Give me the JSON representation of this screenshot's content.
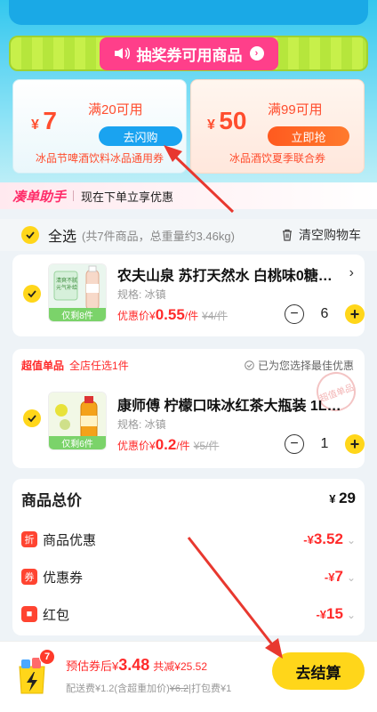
{
  "banner": {
    "title": "抽奖券可用商品"
  },
  "coupons": [
    {
      "currency": "¥",
      "amount": "7",
      "condition": "满20可用",
      "button": "去闪购",
      "desc": "冰品节啤酒饮料冰品通用券"
    },
    {
      "currency": "¥",
      "amount": "50",
      "condition": "满99可用",
      "button": "立即抢",
      "desc": "冰品酒饮夏季联合券"
    }
  ],
  "helper": {
    "tag": "凑单助手",
    "text": "现在下单立享优惠"
  },
  "select_all": {
    "label": "全选",
    "summary": "(共7件商品，总重量约3.46kg)",
    "clear": "清空购物车"
  },
  "products": [
    {
      "name": "农夫山泉 苏打天然水 白桃味0糖…",
      "spec": "规格: 冰镇",
      "price_label": "优惠价",
      "price_currency": "¥",
      "price": "0.55",
      "price_unit": "/件",
      "original": "¥4/件",
      "qty": "6",
      "badge": "仅剩8件"
    },
    {
      "name": "康师傅 柠檬口味冰红茶大瓶装 1L…",
      "spec": "规格: 冰镇",
      "price_label": "优惠价",
      "price_currency": "¥",
      "price": "0.2",
      "price_unit": "/件",
      "original": "¥5/件",
      "qty": "1",
      "badge": "仅剩6件",
      "tag1": "超值单品",
      "tag2": "全店任选1件",
      "best_option": "已为您选择最佳优惠",
      "stamp": "超值单品"
    }
  ],
  "summary": {
    "total_label": "商品总价",
    "total_currency": "¥",
    "total_value": "29",
    "rows": [
      {
        "icon": "折",
        "label": "商品优惠",
        "prefix": "-¥",
        "value": "3.52"
      },
      {
        "icon": "券",
        "label": "优惠券",
        "prefix": "-¥",
        "value": "7"
      },
      {
        "icon": "■",
        "label": "红包",
        "prefix": "-¥",
        "value": "15"
      }
    ]
  },
  "bottom": {
    "cart_count": "7",
    "est_label": "预估券后",
    "est_currency": "¥",
    "est_value": "3.48",
    "saved": "共减¥25.52",
    "fee_prefix": "配送费¥1.2(含超重加价)",
    "fee_strike": "¥6.2",
    "fee_suffix": "|打包费¥1",
    "checkout": "去结算"
  },
  "colors": {
    "accent": "#ffd61a",
    "price": "#ff2b2b",
    "coupon_blue": "#1aa3f0",
    "arrow": "#e8382f"
  }
}
